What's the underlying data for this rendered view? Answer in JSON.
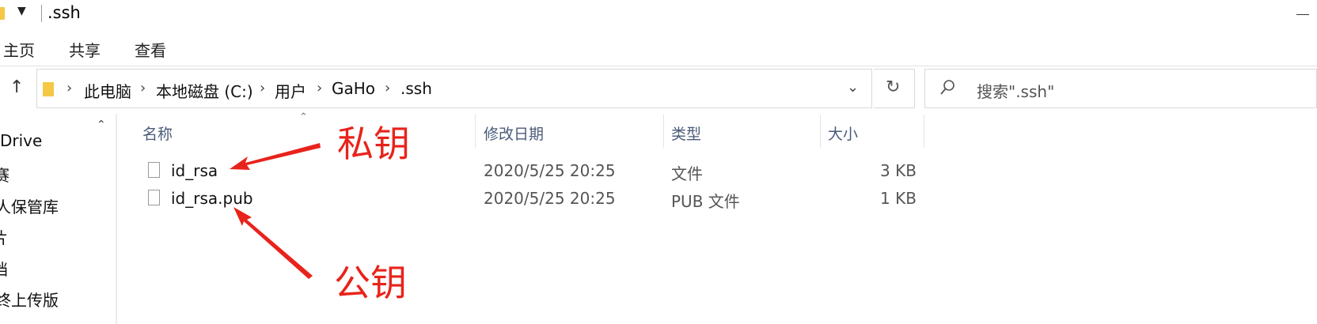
{
  "window": {
    "title": ".ssh"
  },
  "ribbon": {
    "tabs": [
      "主页",
      "共享",
      "查看"
    ]
  },
  "address": {
    "breadcrumb": [
      "此电脑",
      "本地磁盘 (C:)",
      "用户",
      "GaHo",
      ".ssh"
    ],
    "search_placeholder": "搜索\".ssh\""
  },
  "nav": {
    "items": [
      "Drive",
      "赛",
      "人保管库",
      "片",
      "档",
      "终上传版"
    ]
  },
  "columns": {
    "name": "名称",
    "modified": "修改日期",
    "type": "类型",
    "size": "大小"
  },
  "files": [
    {
      "name": "id_rsa",
      "modified": "2020/5/25 20:25",
      "type": "文件",
      "size": "3 KB"
    },
    {
      "name": "id_rsa.pub",
      "modified": "2020/5/25 20:25",
      "type": "PUB 文件",
      "size": "1 KB"
    }
  ],
  "annotations": {
    "private_key": "私钥",
    "public_key": "公钥"
  },
  "colors": {
    "annotation": "#e8231b",
    "folder": "#f5c744",
    "header_text": "#4a5b79"
  }
}
